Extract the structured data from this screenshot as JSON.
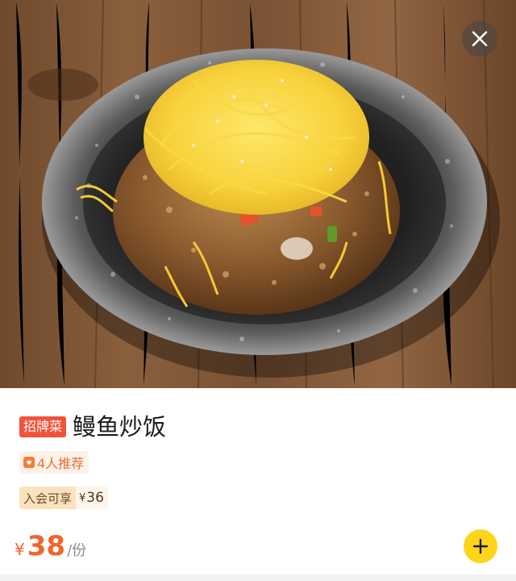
{
  "dish": {
    "badge": "招牌菜",
    "name": "鳗鱼炒饭",
    "recommend_text": "4人推荐",
    "member_label": "入会可享",
    "member_currency": "¥",
    "member_price": "36",
    "currency": "¥",
    "price": "38",
    "unit": "/份"
  },
  "icons": {
    "close": "close-icon",
    "add": "plus-icon",
    "recommend": "recommend-icon"
  },
  "colors": {
    "accent": "#f2632d",
    "badge_bg": "#f3513a",
    "add_button": "#fdd51a",
    "member_label_bg": "#fbe2bd"
  }
}
